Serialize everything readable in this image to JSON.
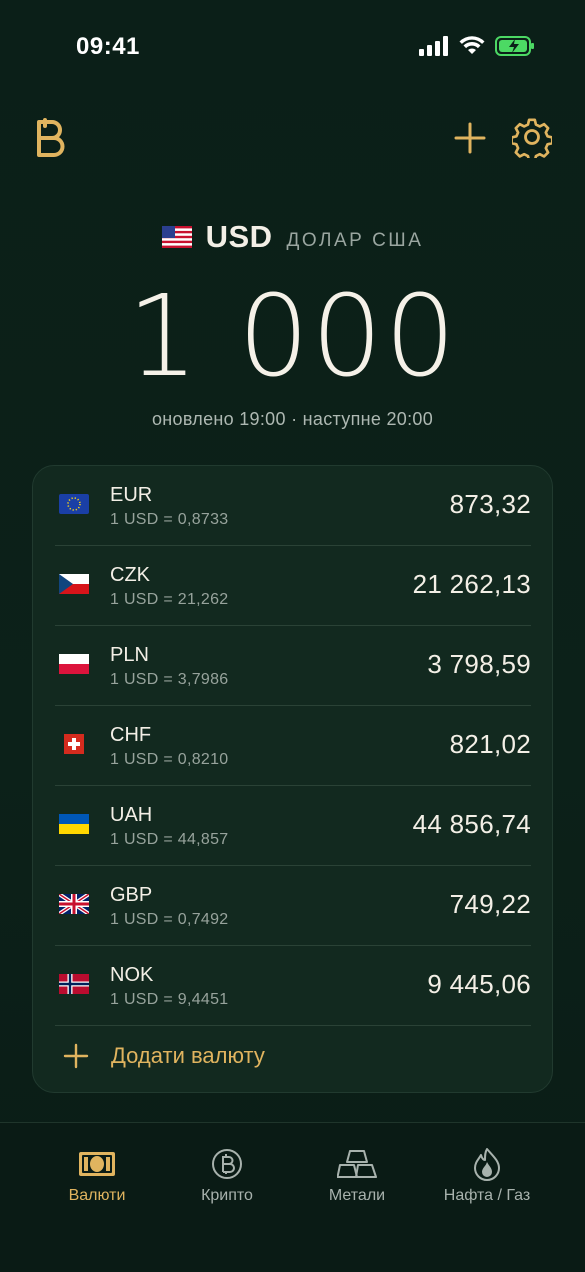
{
  "status_bar": {
    "time": "09:41"
  },
  "colors": {
    "accent": "#e0b45f",
    "background": "#0b1f18",
    "card": "#12291f",
    "battery": "#4cd964"
  },
  "header": {
    "logo_icon": "b-logo-icon",
    "add_icon": "plus-icon",
    "settings_icon": "gear-icon"
  },
  "base": {
    "flag": "us-flag",
    "code": "USD",
    "name": "ДОЛАР США",
    "amount": "1 000",
    "updated": "оновлено 19:00 · наступне 20:00"
  },
  "rates": [
    {
      "flag": "eu-flag",
      "code": "EUR",
      "rate": "1 USD = 0,8733",
      "value": "873,32"
    },
    {
      "flag": "cz-flag",
      "code": "CZK",
      "rate": "1 USD = 21,262",
      "value": "21 262,13"
    },
    {
      "flag": "pl-flag",
      "code": "PLN",
      "rate": "1 USD = 3,7986",
      "value": "3 798,59"
    },
    {
      "flag": "ch-flag",
      "code": "CHF",
      "rate": "1 USD = 0,8210",
      "value": "821,02"
    },
    {
      "flag": "ua-flag",
      "code": "UAH",
      "rate": "1 USD = 44,857",
      "value": "44 856,74"
    },
    {
      "flag": "gb-flag",
      "code": "GBP",
      "rate": "1 USD = 0,7492",
      "value": "749,22"
    },
    {
      "flag": "no-flag",
      "code": "NOK",
      "rate": "1 USD = 9,4451",
      "value": "9 445,06"
    }
  ],
  "add_currency": {
    "label": "Додати валюту",
    "icon": "plus-icon"
  },
  "tabs": [
    {
      "label": "Валюти",
      "icon": "banknote-icon",
      "active": true
    },
    {
      "label": "Крипто",
      "icon": "bitcoin-icon",
      "active": false
    },
    {
      "label": "Метали",
      "icon": "gold-bars-icon",
      "active": false
    },
    {
      "label": "Нафта / Газ",
      "icon": "flame-icon",
      "active": false
    }
  ]
}
